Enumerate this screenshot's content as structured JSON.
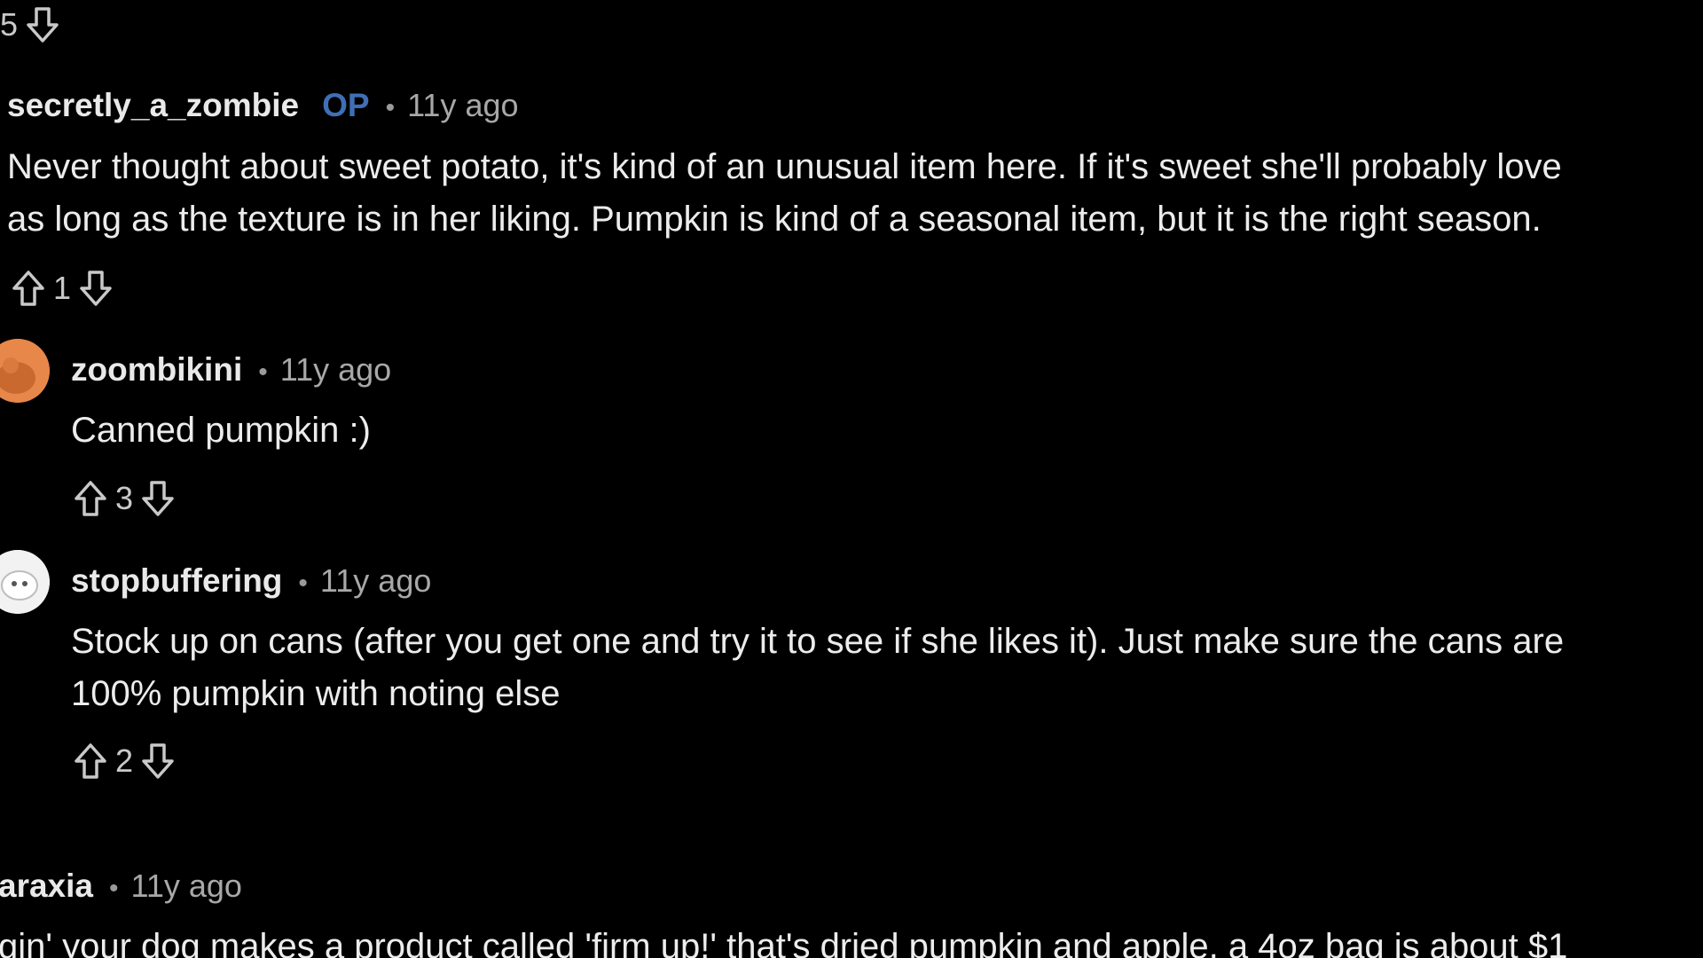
{
  "top_fragment": {
    "score": "5"
  },
  "comments": [
    {
      "author": "secretly_a_zombie",
      "op_badge": "OP",
      "separator": "•",
      "age": "11y ago",
      "lines": [
        "Never thought about sweet potato, it's kind of an unusual item here. If it's sweet she'll probably love",
        "as long as the texture is in her liking. Pumpkin is kind of a seasonal item, but it is the right season."
      ],
      "score": "1"
    },
    {
      "author": "zoombikini",
      "separator": "•",
      "age": "11y ago",
      "avatar_color": "#e8874a",
      "lines": [
        "Canned pumpkin :)"
      ],
      "score": "3"
    },
    {
      "author": "stopbuffering",
      "separator": "•",
      "age": "11y ago",
      "avatar_color": "#f2f2f2",
      "lines": [
        "Stock up on cans (after you get one and try it to see if she likes it). Just make sure the cans are",
        "100% pumpkin with noting else"
      ],
      "score": "2"
    },
    {
      "author": "araxia",
      "separator": "•",
      "age": "11y ago",
      "lines": [
        "gin' your dog makes a product called 'firm up!' that's dried pumpkin and apple, a 4oz bag is about $1"
      ]
    }
  ],
  "icons": {
    "upvote": "arrow-up-outline-icon",
    "downvote": "arrow-down-outline-icon"
  },
  "colors": {
    "background": "#000000",
    "op_badge": "#3f6fb5",
    "muted_text": "#a8a8a8"
  }
}
